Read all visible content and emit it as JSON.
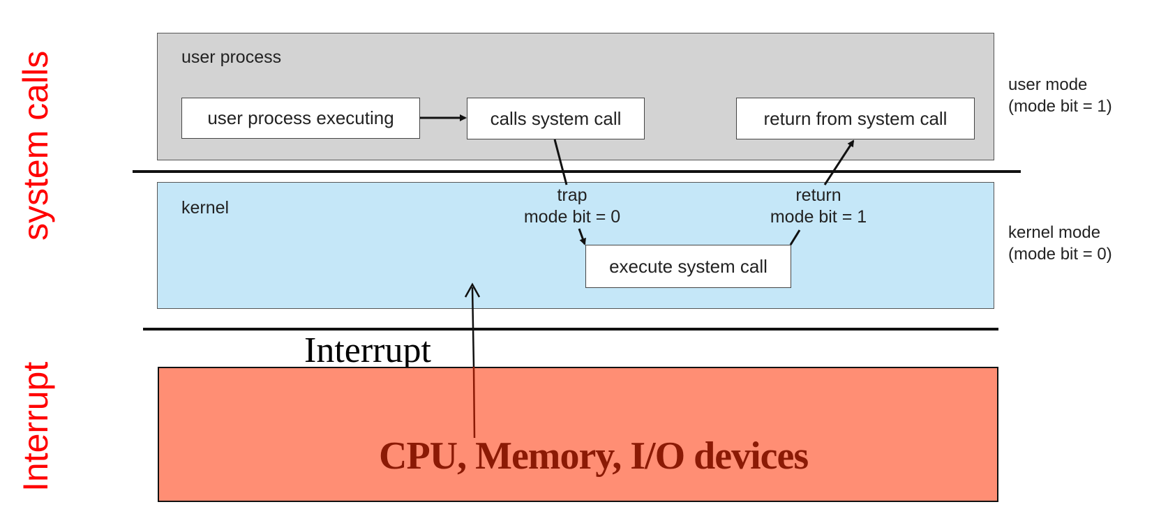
{
  "side_labels": {
    "top": "system calls",
    "bottom": "Interrupt"
  },
  "user_panel": {
    "title": "user process",
    "nodes": {
      "executing": "user process executing",
      "calls": "calls system call",
      "return_from": "return from system call"
    },
    "mode_label": {
      "line1": "user mode",
      "line2": "(mode bit = 1)"
    }
  },
  "kernel_panel": {
    "title": "kernel",
    "trap_note": {
      "line1": "trap",
      "line2": "mode bit = 0"
    },
    "return_note": {
      "line1": "return",
      "line2": "mode bit = 1"
    },
    "nodes": {
      "execute": "execute system call"
    },
    "mode_label": {
      "line1": "kernel mode",
      "line2": "(mode bit = 0)"
    }
  },
  "interrupt_label": "Interrupt",
  "hardware_panel": {
    "label": "CPU, Memory, I/O devices"
  },
  "colors": {
    "side_label": "#ff0000",
    "user_panel": "#d3d3d3",
    "kernel_panel": "#c5e7f8",
    "hardware_panel": "#ff8e74",
    "hardware_text": "#8b1a05"
  }
}
